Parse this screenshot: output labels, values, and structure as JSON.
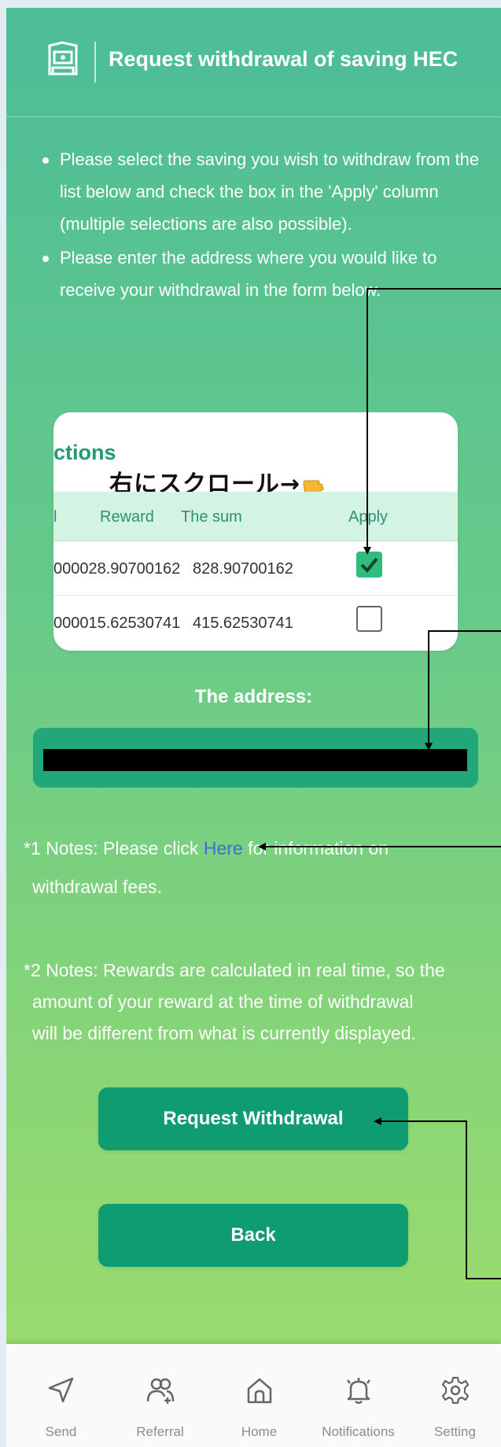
{
  "header": {
    "title": "Request withdrawal of saving HEC"
  },
  "instructions": [
    "Please select the saving you wish to withdraw from the list below and check the box in the 'Apply' column (multiple selections are also possible).",
    "Please enter the address where you would like to receive your withdrawal in the form below."
  ],
  "card": {
    "title": "ctions",
    "scroll_hint": "右にスクロール→",
    "columns": [
      "l",
      "Reward",
      "The sum",
      "Apply"
    ],
    "rows": [
      {
        "reward": "000028.90700162",
        "sum": "828.90700162",
        "apply": true
      },
      {
        "reward": "000015.62530741",
        "sum": "415.62530741",
        "apply": false
      }
    ]
  },
  "address": {
    "label": "The address:",
    "value": ""
  },
  "notes": {
    "note1_prefix": "*1 Notes: Please click ",
    "note1_link": "Here",
    "note1_suffix": " for information on",
    "note1_line2": "withdrawal fees.",
    "note2_line1": "*2 Notes: Rewards are calculated in real time, so the",
    "note2_line2": "amount of your reward at the time of withdrawal",
    "note2_line3": "will be different from what is currently displayed."
  },
  "buttons": {
    "request": "Request Withdrawal",
    "back": "Back"
  },
  "nav": [
    {
      "label": "Send",
      "icon": "send-icon"
    },
    {
      "label": "Referral",
      "icon": "referral-icon"
    },
    {
      "label": "Home",
      "icon": "home-icon"
    },
    {
      "label": "Notifications",
      "icon": "bell-icon"
    },
    {
      "label": "Setting",
      "icon": "gear-icon"
    }
  ],
  "colors": {
    "accent": "#0f9c70",
    "checkbox": "#2ebd7a",
    "link": "#3a6edb"
  }
}
